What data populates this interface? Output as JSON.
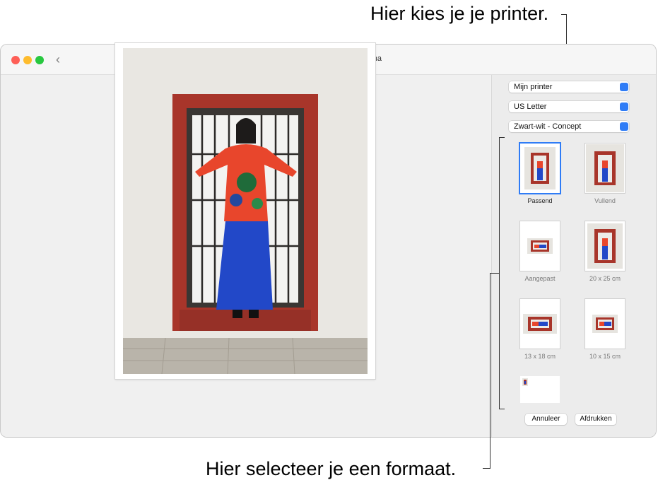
{
  "annotations": {
    "printer_callout": "Hier kies je je printer.",
    "format_callout": "Hier selecteer je een formaat."
  },
  "window": {
    "title": "Druk één foto af op één pagina",
    "back_icon": "chevron-left-icon"
  },
  "settings": {
    "printer": "Mijn printer",
    "paper_size": "US Letter",
    "quality": "Zwart-wit - Concept"
  },
  "sizes": [
    {
      "label": "Passend",
      "selected": true
    },
    {
      "label": "Vullend",
      "selected": false
    },
    {
      "label": "Aangepast",
      "selected": false
    },
    {
      "label": "20 x 25 cm",
      "selected": false
    },
    {
      "label": "13 x 18 cm",
      "selected": false
    },
    {
      "label": "10 x 15 cm",
      "selected": false
    },
    {
      "label": "",
      "selected": false
    }
  ],
  "buttons": {
    "cancel": "Annuleer",
    "print": "Afdrukken"
  },
  "colors": {
    "accent": "#2f7cf6",
    "frame_red": "#a8352a",
    "jacket_red": "#e8462c",
    "skirt_blue": "#2248c8"
  }
}
